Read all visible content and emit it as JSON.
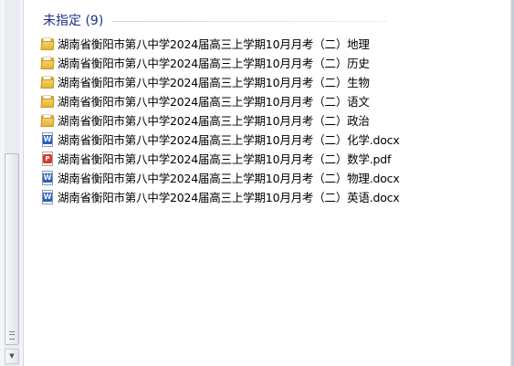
{
  "group": {
    "title": "未指定 (9)"
  },
  "scrollbar": {
    "down_arrow": "▼"
  },
  "files": [
    {
      "name": "湖南省衡阳市第八中学2024届高三上学期10月月考（二）地理",
      "type": "folder",
      "icon": "folder-icon"
    },
    {
      "name": "湖南省衡阳市第八中学2024届高三上学期10月月考（二）历史",
      "type": "folder",
      "icon": "folder-icon"
    },
    {
      "name": "湖南省衡阳市第八中学2024届高三上学期10月月考（二）生物",
      "type": "folder",
      "icon": "folder-icon"
    },
    {
      "name": "湖南省衡阳市第八中学2024届高三上学期10月月考（二）语文",
      "type": "folder",
      "icon": "folder-icon"
    },
    {
      "name": "湖南省衡阳市第八中学2024届高三上学期10月月考（二）政治",
      "type": "folder",
      "icon": "folder-icon"
    },
    {
      "name": "湖南省衡阳市第八中学2024届高三上学期10月月考（二）化学.docx",
      "type": "docx",
      "icon": "word-doc-icon",
      "badge": "W"
    },
    {
      "name": "湖南省衡阳市第八中学2024届高三上学期10月月考（二）数学.pdf",
      "type": "pdf",
      "icon": "pdf-icon",
      "badge": "P"
    },
    {
      "name": "湖南省衡阳市第八中学2024届高三上学期10月月考（二）物理.docx",
      "type": "docx",
      "icon": "word-doc-icon",
      "badge": "W"
    },
    {
      "name": "湖南省衡阳市第八中学2024届高三上学期10月月考（二）英语.docx",
      "type": "docx",
      "icon": "word-doc-icon",
      "badge": "W"
    }
  ],
  "colors": {
    "group_title": "#1e3287",
    "folder": "#e7b233",
    "word": "#2b5fb7",
    "pdf": "#d23a2f"
  }
}
